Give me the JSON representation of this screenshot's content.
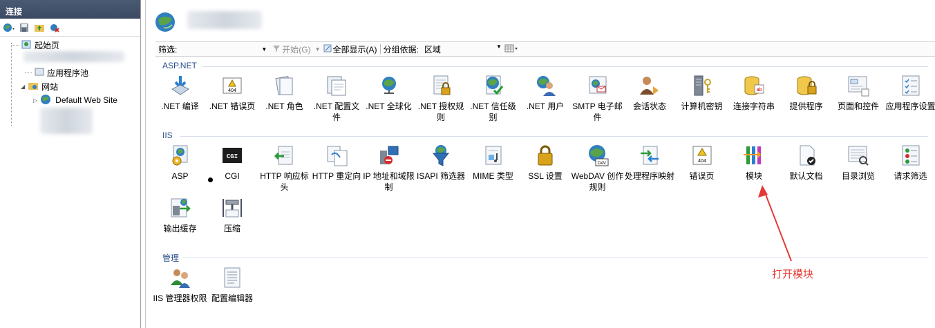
{
  "connections": {
    "title": "连接",
    "tree": {
      "start_page": "起始页",
      "app_pools": "应用程序池",
      "sites": "网站",
      "default_site": "Default Web Site"
    }
  },
  "filter_bar": {
    "filter_label": "筛选:",
    "start_label": "开始(G)",
    "show_all_label": "全部显示(A)",
    "group_by_label": "分组依据:",
    "group_by_value": "区域"
  },
  "sections": {
    "aspnet": {
      "label": "ASP.NET",
      "items": [
        {
          "label": ".NET 编译",
          "icon": "download-arrow-icon"
        },
        {
          "label": ".NET 错误页",
          "icon": "error-404-icon"
        },
        {
          "label": ".NET 角色",
          "icon": "pages-icon"
        },
        {
          "label": ".NET 配置文件",
          "icon": "document-stack-icon"
        },
        {
          "label": ".NET 全球化",
          "icon": "globe-stand-icon"
        },
        {
          "label": ".NET 授权规则",
          "icon": "lock-document-icon"
        },
        {
          "label": ".NET 信任级别",
          "icon": "globe-check-icon"
        },
        {
          "label": ".NET 用户",
          "icon": "user-globe-icon"
        },
        {
          "label": "SMTP 电子邮件",
          "icon": "mail-icon"
        },
        {
          "label": "会话状态",
          "icon": "user-session-icon"
        },
        {
          "label": "计算机密钥",
          "icon": "server-key-icon"
        },
        {
          "label": "连接字符串",
          "icon": "database-icon"
        },
        {
          "label": "提供程序",
          "icon": "database-lock-icon"
        },
        {
          "label": "页面和控件",
          "icon": "page-controls-icon"
        },
        {
          "label": "应用程序设置",
          "icon": "settings-list-icon"
        }
      ]
    },
    "iis": {
      "label": "IIS",
      "items": [
        {
          "label": "ASP",
          "icon": "asp-gear-icon"
        },
        {
          "label": "CGI",
          "icon": "cgi-icon"
        },
        {
          "label": "HTTP 响应标头",
          "icon": "response-headers-icon"
        },
        {
          "label": "HTTP 重定向",
          "icon": "redirect-icon"
        },
        {
          "label": "IP 地址和域限制",
          "icon": "ip-restrict-icon"
        },
        {
          "label": "ISAPI 筛选器",
          "icon": "filter-funnel-icon"
        },
        {
          "label": "MIME 类型",
          "icon": "mime-icon"
        },
        {
          "label": "SSL 设置",
          "icon": "padlock-icon"
        },
        {
          "label": "WebDAV 创作规则",
          "icon": "webdav-globe-icon"
        },
        {
          "label": "处理程序映射",
          "icon": "handler-arrows-icon"
        },
        {
          "label": "错误页",
          "icon": "error-404-warning-icon"
        },
        {
          "label": "模块",
          "icon": "modules-icon"
        },
        {
          "label": "默认文档",
          "icon": "default-doc-icon"
        },
        {
          "label": "目录浏览",
          "icon": "directory-browse-icon"
        },
        {
          "label": "请求筛选",
          "icon": "request-filter-icon"
        },
        {
          "label": "输出缓存",
          "icon": "output-cache-icon"
        },
        {
          "label": "压缩",
          "icon": "compress-clamp-icon"
        }
      ]
    },
    "manage": {
      "label": "管理",
      "items": [
        {
          "label": "IIS 管理器权限",
          "icon": "admin-users-icon"
        },
        {
          "label": "配置编辑器",
          "icon": "config-editor-icon"
        }
      ]
    }
  },
  "annotation": {
    "text": "打开模块",
    "color": "#e53935"
  }
}
